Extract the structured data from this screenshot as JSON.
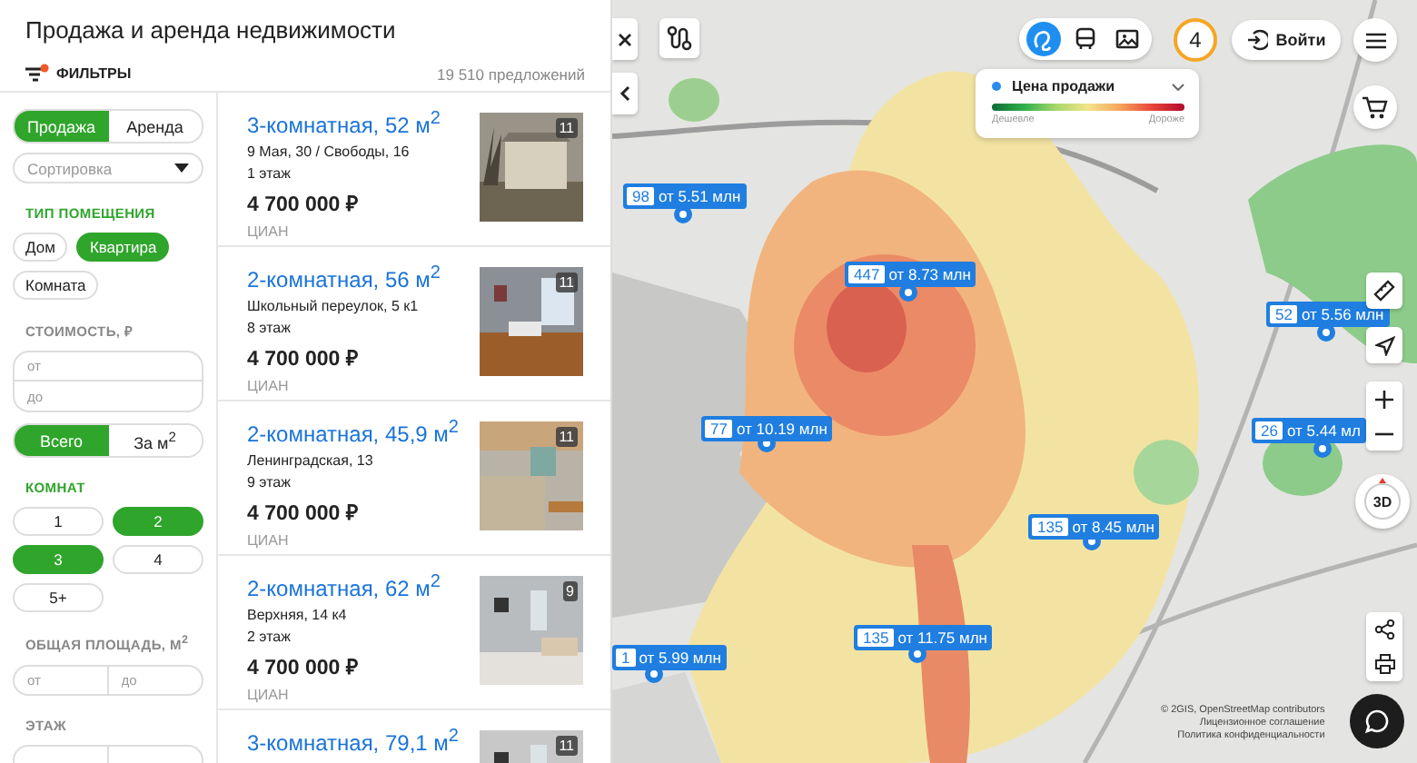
{
  "header": {
    "title": "Продажа и аренда недвижимости",
    "filters_label": "ФИЛЬТРЫ",
    "offers_count": "19 510 предложений"
  },
  "filters": {
    "deal_tabs": [
      {
        "label": "Продажа",
        "selected": true
      },
      {
        "label": "Аренда",
        "selected": false
      }
    ],
    "sort": {
      "placeholder": "Сортировка"
    },
    "sections": [
      {
        "kind": "chips",
        "heading": "ТИП ПОМЕЩЕНИЯ",
        "active": true,
        "options": [
          {
            "label": "Дом",
            "selected": false
          },
          {
            "label": "Квартира",
            "selected": true
          },
          {
            "label": "Комната",
            "selected": false
          }
        ]
      },
      {
        "kind": "range",
        "heading": "СТОИМОСТЬ, ₽",
        "active": false,
        "from": {
          "placeholder": "от"
        },
        "to": {
          "placeholder": "до"
        }
      },
      {
        "kind": "toggle",
        "options": [
          {
            "label": "Всего",
            "selected": true
          },
          {
            "label": "За м$^{2}$",
            "selected": false
          }
        ]
      },
      {
        "kind": "grid",
        "heading": "КОМНАТ",
        "active": true,
        "options": [
          {
            "label": "1",
            "selected": false
          },
          {
            "label": "2",
            "selected": true
          },
          {
            "label": "3",
            "selected": true
          },
          {
            "label": "4",
            "selected": false
          },
          {
            "label": "5+",
            "selected": false
          }
        ]
      },
      {
        "kind": "pair",
        "heading": "ОБЩАЯ ПЛОЩАДЬ, М$^{2}$",
        "active": false,
        "from": {
          "placeholder": "от"
        },
        "to": {
          "placeholder": "до"
        }
      },
      {
        "kind": "pair",
        "heading": "ЭТАЖ",
        "active": false
      }
    ]
  },
  "listings": [
    {
      "title": "3-комнатная, 52 м$^{2}$",
      "address": "9 Мая, 30 / Свободы, 16",
      "floor": "1 этаж",
      "price": "4 700 000 ₽",
      "source": "ЦИАН",
      "photos": "11"
    },
    {
      "title": "2-комнатная, 56 м$^{2}$",
      "address": "Школьный переулок, 5 к1",
      "floor": "8 этаж",
      "price": "4 700 000 ₽",
      "source": "ЦИАН",
      "photos": "11"
    },
    {
      "title": "2-комнатная, 45,9 м$^{2}$",
      "address": "Ленинградская, 13",
      "floor": "9 этаж",
      "price": "4 700 000 ₽",
      "source": "ЦИАН",
      "photos": "11"
    },
    {
      "title": "2-комнатная, 62 м$^{2}$",
      "address": "Верхняя, 14 к4",
      "floor": "2 этаж",
      "price": "4 700 000 ₽",
      "source": "ЦИАН",
      "photos": "9"
    },
    {
      "title": "3-комнатная, 79,1 м$^{2}$",
      "photos": "11"
    }
  ],
  "map": {
    "layers": [
      {
        "selected": true
      },
      {
        "selected": false
      },
      {
        "selected": false
      }
    ],
    "notifications": "4",
    "login": "Войти",
    "legend": {
      "label": "Цена продажи",
      "low": "Дешевле",
      "high": "Дороже"
    },
    "clusters": [
      {
        "count": "98",
        "price": "от 5.51 млн"
      },
      {
        "count": "447",
        "price": "от 8.73 млн"
      },
      {
        "count": "77",
        "price": "от 10.19 млн"
      },
      {
        "count": "135",
        "price": "от 8.45 млн"
      },
      {
        "count": "135",
        "price": "от 11.75 млн"
      },
      {
        "count": "1",
        "price": "от 5.99 млн"
      },
      {
        "count": "52",
        "price": "от 5.56 млн"
      },
      {
        "count": "26",
        "price": "от 5.44 мл"
      }
    ],
    "compass": "3D",
    "attribution": [
      "© 2GIS, OpenStreetMap contributors",
      "Лицензионное соглашение",
      "Политика конфиденциальности"
    ]
  }
}
